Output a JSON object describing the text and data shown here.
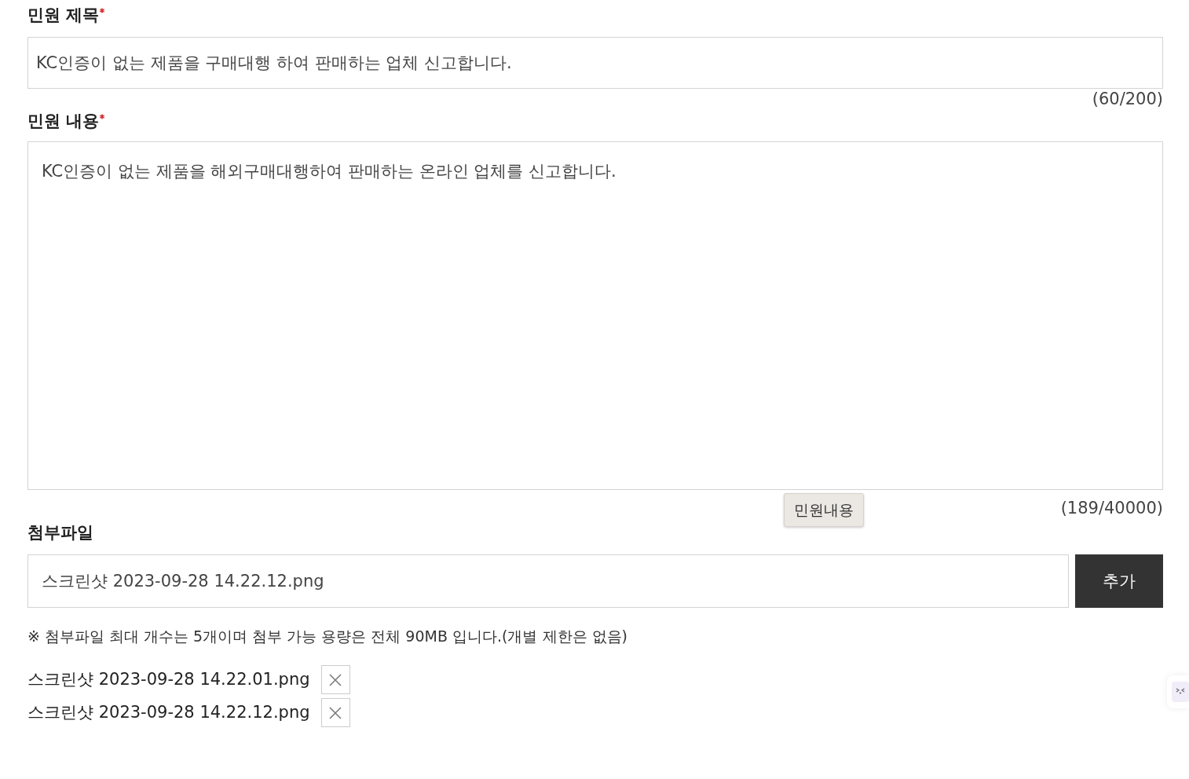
{
  "fields": [
    {
      "kind": "text",
      "label": "민원 제목",
      "required": true,
      "value": "KC인증이 없는 제품을 구매대행 하여 판매하는 업체 신고합니다.",
      "counter": "(60/200)"
    },
    {
      "kind": "textarea",
      "label": "민원 내용",
      "required": true,
      "value": "KC인증이 없는 제품을 해외구매대행하여 판매하는 온라인 업체를 신고합니다.",
      "counter": "(189/40000)",
      "tooltip": "민원내용"
    },
    {
      "kind": "file",
      "label": "첨부파일",
      "required": false,
      "value": "스크린샷 2023-09-28 14.22.12.png",
      "button": "추가",
      "note": "※ 첨부파일 최대 개수는 5개이며 첨부 가능 용량은 전체 90MB 입니다.(개별 제한은 없음)",
      "files": [
        "스크린샷 2023-09-28 14.22.01.png",
        "스크린샷 2023-09-28 14.22.12.png"
      ]
    }
  ]
}
